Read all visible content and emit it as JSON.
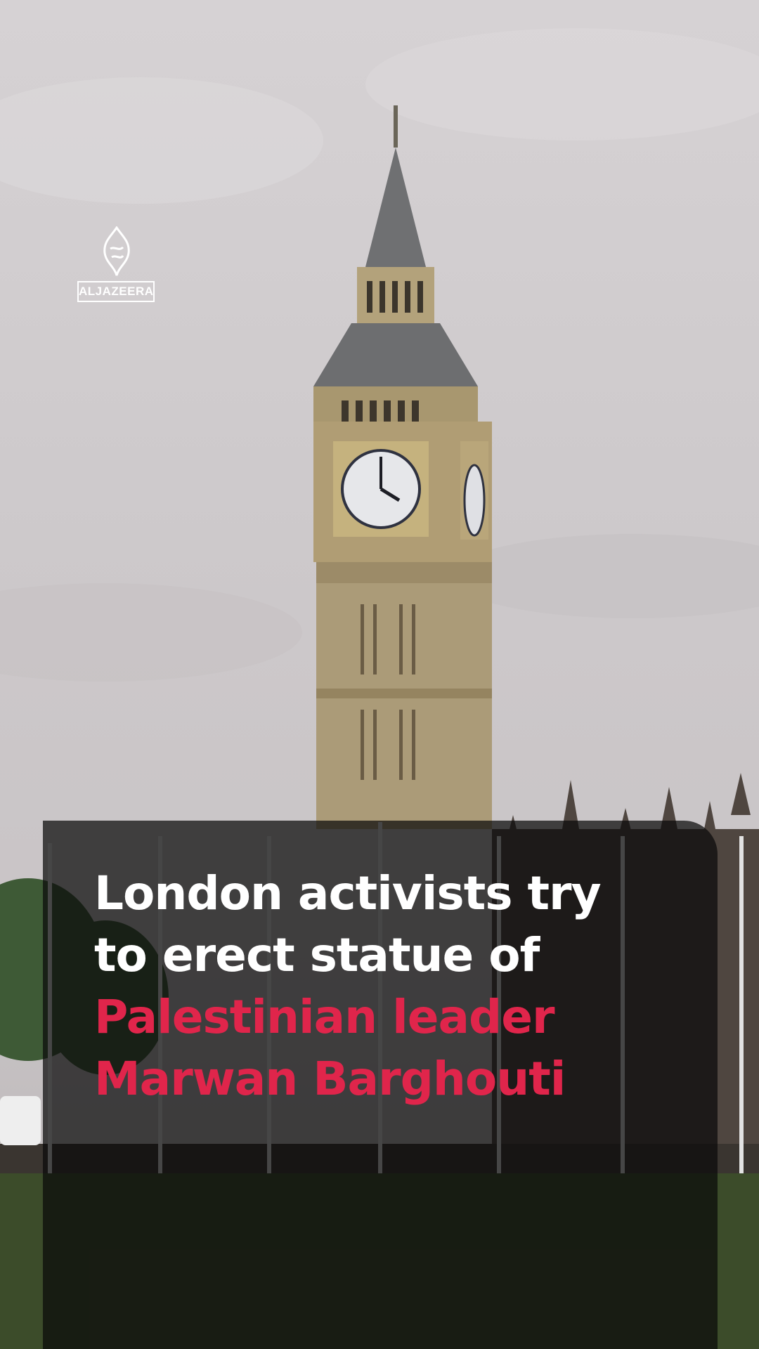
{
  "brand": {
    "name": "ALJAZEERA",
    "logo_icon": "al-jazeera-calligraphy-icon"
  },
  "headline": {
    "line1": "London activists try",
    "line2": "to erect statue of",
    "line3": "Palestinian leader",
    "line4": "Marwan Barghouti"
  },
  "colors": {
    "headline_white": "#ffffff",
    "headline_accent": "#e0254b",
    "panel": "#0a0a0a"
  }
}
